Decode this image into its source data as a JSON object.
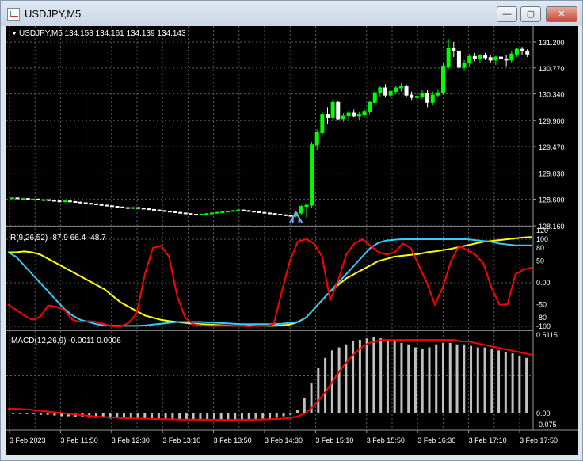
{
  "window": {
    "title": "USDJPY,M5",
    "minimize_glyph": "—",
    "maximize_glyph": "▢",
    "close_glyph": "✕"
  },
  "colors": {
    "background": "#000000",
    "grid": "#5a5a5a",
    "bull_candle": "#00ff00",
    "bear_candle": "#ffffff",
    "rsi_fast": "#ff0000",
    "rsi_mid": "#33ccff",
    "rsi_slow": "#ffff00",
    "macd_hist": "#c0c0c0",
    "macd_signal": "#ff0000",
    "arrow": "#6fa8ff"
  },
  "main_panel": {
    "header": "USDJPY,M5  134.158 134.161 134.139 134.143",
    "price_ticks": [
      "131.200",
      "130.770",
      "130.340",
      "129.900",
      "129.470",
      "129.030",
      "128.600",
      "128.160"
    ]
  },
  "rsi_panel": {
    "header": "R(9,26,52) -87.9 66.4 -48.7",
    "ticks": [
      "120",
      "100",
      "80",
      "50",
      "0.00",
      "-50",
      "-80",
      "-100"
    ]
  },
  "macd_panel": {
    "header": "MACD(12,26,9) -0.0011 0.0006",
    "ticks": [
      "0.5115",
      "0.00",
      "-0.075"
    ]
  },
  "time_labels": [
    "3 Feb 2023",
    "3 Feb 11:50",
    "3 Feb 12:30",
    "3 Feb 13:10",
    "3 Feb 13:50",
    "3 Feb 14:30",
    "3 Feb 15:10",
    "3 Feb 15:50",
    "3 Feb 16:30",
    "3 Feb 17:10",
    "3 Feb 17:50"
  ],
  "chart_data": {
    "type": "candlestick",
    "symbol": "USDJPY",
    "timeframe": "M5",
    "ylim": [
      128.16,
      131.2
    ],
    "candles_ohlc": [
      [
        128.62,
        128.63,
        128.61,
        128.62
      ],
      [
        128.62,
        128.63,
        128.6,
        128.61
      ],
      [
        128.61,
        128.62,
        128.6,
        128.61
      ],
      [
        128.61,
        128.62,
        128.59,
        128.6
      ],
      [
        128.6,
        128.61,
        128.59,
        128.6
      ],
      [
        128.6,
        128.61,
        128.58,
        128.59
      ],
      [
        128.59,
        128.6,
        128.58,
        128.59
      ],
      [
        128.59,
        128.6,
        128.57,
        128.58
      ],
      [
        128.58,
        128.59,
        128.56,
        128.57
      ],
      [
        128.57,
        128.58,
        128.55,
        128.56
      ],
      [
        128.56,
        128.58,
        128.55,
        128.57
      ],
      [
        128.57,
        128.58,
        128.55,
        128.56
      ],
      [
        128.56,
        128.57,
        128.54,
        128.55
      ],
      [
        128.55,
        128.56,
        128.53,
        128.54
      ],
      [
        128.54,
        128.55,
        128.52,
        128.53
      ],
      [
        128.53,
        128.54,
        128.51,
        128.52
      ],
      [
        128.52,
        128.53,
        128.5,
        128.51
      ],
      [
        128.51,
        128.52,
        128.49,
        128.5
      ],
      [
        128.5,
        128.51,
        128.48,
        128.49
      ],
      [
        128.49,
        128.5,
        128.47,
        128.48
      ],
      [
        128.48,
        128.49,
        128.46,
        128.47
      ],
      [
        128.47,
        128.48,
        128.45,
        128.46
      ],
      [
        128.46,
        128.47,
        128.44,
        128.45
      ],
      [
        128.45,
        128.47,
        128.44,
        128.46
      ],
      [
        128.46,
        128.47,
        128.44,
        128.45
      ],
      [
        128.45,
        128.46,
        128.43,
        128.44
      ],
      [
        128.44,
        128.45,
        128.42,
        128.43
      ],
      [
        128.43,
        128.44,
        128.41,
        128.42
      ],
      [
        128.42,
        128.43,
        128.4,
        128.41
      ],
      [
        128.41,
        128.42,
        128.39,
        128.4
      ],
      [
        128.4,
        128.41,
        128.38,
        128.39
      ],
      [
        128.39,
        128.4,
        128.37,
        128.38
      ],
      [
        128.38,
        128.39,
        128.36,
        128.37
      ],
      [
        128.37,
        128.38,
        128.35,
        128.36
      ],
      [
        128.36,
        128.37,
        128.34,
        128.35
      ],
      [
        128.35,
        128.36,
        128.33,
        128.34
      ],
      [
        128.34,
        128.36,
        128.33,
        128.35
      ],
      [
        128.35,
        128.37,
        128.34,
        128.36
      ],
      [
        128.36,
        128.38,
        128.35,
        128.37
      ],
      [
        128.37,
        128.39,
        128.36,
        128.38
      ],
      [
        128.38,
        128.4,
        128.37,
        128.39
      ],
      [
        128.39,
        128.41,
        128.38,
        128.4
      ],
      [
        128.4,
        128.42,
        128.39,
        128.41
      ],
      [
        128.41,
        128.43,
        128.4,
        128.42
      ],
      [
        128.42,
        128.43,
        128.4,
        128.41
      ],
      [
        128.41,
        128.42,
        128.39,
        128.4
      ],
      [
        128.4,
        128.41,
        128.38,
        128.39
      ],
      [
        128.39,
        128.4,
        128.37,
        128.38
      ],
      [
        128.38,
        128.39,
        128.36,
        128.37
      ],
      [
        128.37,
        128.38,
        128.35,
        128.36
      ],
      [
        128.36,
        128.37,
        128.34,
        128.35
      ],
      [
        128.35,
        128.36,
        128.33,
        128.34
      ],
      [
        128.34,
        128.35,
        128.32,
        128.33
      ],
      [
        128.33,
        128.34,
        128.31,
        128.32
      ],
      [
        128.32,
        128.38,
        128.3,
        128.37
      ],
      [
        128.37,
        128.5,
        128.34,
        128.48
      ],
      [
        128.48,
        128.52,
        128.3,
        128.5
      ],
      [
        128.5,
        129.55,
        128.45,
        129.5
      ],
      [
        129.5,
        129.75,
        129.4,
        129.7
      ],
      [
        129.7,
        130.05,
        129.65,
        130.0
      ],
      [
        130.0,
        130.12,
        129.85,
        129.95
      ],
      [
        129.95,
        130.25,
        129.9,
        130.2
      ],
      [
        130.2,
        130.22,
        129.9,
        129.93
      ],
      [
        129.93,
        130.02,
        129.88,
        129.98
      ],
      [
        129.98,
        130.06,
        129.92,
        130.02
      ],
      [
        130.02,
        130.08,
        129.95,
        129.97
      ],
      [
        129.97,
        130.05,
        129.9,
        130.0
      ],
      [
        130.0,
        130.1,
        129.95,
        130.05
      ],
      [
        130.05,
        130.22,
        130.0,
        130.2
      ],
      [
        130.2,
        130.4,
        130.15,
        130.36
      ],
      [
        130.36,
        130.48,
        130.3,
        130.44
      ],
      [
        130.44,
        130.5,
        130.28,
        130.32
      ],
      [
        130.32,
        130.42,
        130.27,
        130.38
      ],
      [
        130.38,
        130.47,
        130.33,
        130.44
      ],
      [
        130.44,
        130.52,
        130.38,
        130.47
      ],
      [
        130.47,
        130.5,
        130.28,
        130.32
      ],
      [
        130.32,
        130.38,
        130.24,
        130.28
      ],
      [
        130.28,
        130.35,
        130.22,
        130.3
      ],
      [
        130.3,
        130.4,
        130.25,
        130.35
      ],
      [
        130.35,
        130.4,
        130.12,
        130.2
      ],
      [
        130.2,
        130.38,
        130.15,
        130.32
      ],
      [
        130.32,
        130.42,
        130.28,
        130.36
      ],
      [
        130.36,
        130.85,
        130.32,
        130.8
      ],
      [
        130.8,
        131.25,
        130.75,
        131.1
      ],
      [
        131.1,
        131.2,
        130.95,
        131.05
      ],
      [
        131.05,
        131.08,
        130.7,
        130.78
      ],
      [
        130.78,
        130.9,
        130.72,
        130.85
      ],
      [
        130.85,
        131.0,
        130.8,
        130.96
      ],
      [
        130.96,
        131.02,
        130.88,
        130.92
      ],
      [
        130.92,
        131.0,
        130.85,
        130.97
      ],
      [
        130.97,
        131.02,
        130.9,
        130.94
      ],
      [
        130.94,
        130.98,
        130.85,
        130.9
      ],
      [
        130.9,
        130.97,
        130.82,
        130.95
      ],
      [
        130.95,
        131.0,
        130.88,
        130.92
      ],
      [
        130.92,
        130.98,
        130.8,
        130.9
      ],
      [
        130.9,
        131.05,
        130.85,
        131.0
      ],
      [
        131.0,
        131.1,
        130.95,
        131.08
      ],
      [
        131.08,
        131.12,
        130.98,
        131.05
      ],
      [
        131.05,
        131.08,
        130.95,
        131.0
      ]
    ],
    "signal_arrow": {
      "index": 54,
      "type": "buy"
    },
    "rsi_series": {
      "ylim": [
        -100,
        120
      ],
      "fast": [
        -50,
        -62,
        -75,
        -85,
        -78,
        -52,
        -55,
        -62,
        -85,
        -90,
        -88,
        -90,
        -95,
        -100,
        -100,
        -92,
        -70,
        20,
        80,
        85,
        60,
        -30,
        -80,
        -95,
        -98,
        -99,
        -99,
        -99,
        -99,
        -99,
        -100,
        -99,
        -99,
        -95,
        -20,
        50,
        95,
        100,
        90,
        60,
        -40,
        5,
        65,
        90,
        100,
        85,
        70,
        65,
        70,
        90,
        80,
        40,
        0,
        -50,
        -10,
        50,
        85,
        75,
        65,
        45,
        -10,
        -50,
        -50,
        20,
        30,
        35
      ],
      "mid": [
        70,
        60,
        40,
        20,
        0,
        -20,
        -40,
        -60,
        -75,
        -85,
        -90,
        -95,
        -98,
        -99,
        -99,
        -99,
        -99,
        -98,
        -96,
        -94,
        -92,
        -90,
        -90,
        -90,
        -90,
        -91,
        -92,
        -93,
        -94,
        -95,
        -95,
        -95,
        -95,
        -95,
        -94,
        -92,
        -90,
        -80,
        -60,
        -40,
        -20,
        0,
        20,
        40,
        60,
        80,
        92,
        97,
        99,
        100,
        100,
        100,
        100,
        100,
        100,
        100,
        100,
        100,
        98,
        96,
        94,
        90,
        88,
        86,
        86,
        86
      ],
      "slow": [
        70,
        70,
        72,
        70,
        65,
        55,
        45,
        35,
        25,
        15,
        5,
        -5,
        -15,
        -30,
        -45,
        -55,
        -65,
        -75,
        -80,
        -85,
        -88,
        -90,
        -92,
        -94,
        -95,
        -96,
        -97,
        -98,
        -99,
        -99,
        -99,
        -99,
        -99,
        -99,
        -98,
        -96,
        -90,
        -80,
        -60,
        -40,
        -20,
        -5,
        10,
        20,
        30,
        40,
        50,
        55,
        60,
        62,
        64,
        66,
        70,
        72,
        75,
        78,
        82,
        86,
        90,
        94,
        96,
        98,
        100,
        102,
        104,
        105
      ]
    },
    "macd_series": {
      "ylim": [
        -0.075,
        0.5115
      ],
      "histogram": [
        0.0,
        0.0,
        0.0,
        -0.005,
        -0.01,
        -0.01,
        -0.015,
        -0.02,
        -0.02,
        -0.025,
        -0.025,
        -0.03,
        -0.03,
        -0.03,
        -0.035,
        -0.035,
        -0.035,
        -0.035,
        -0.04,
        -0.04,
        -0.04,
        -0.04,
        -0.04,
        -0.045,
        -0.045,
        -0.045,
        -0.045,
        -0.045,
        -0.045,
        -0.045,
        -0.045,
        -0.045,
        -0.045,
        -0.045,
        -0.04,
        -0.04,
        -0.035,
        -0.035,
        -0.03,
        -0.02,
        -0.01,
        0.02,
        0.1,
        0.2,
        0.3,
        0.37,
        0.42,
        0.44,
        0.46,
        0.48,
        0.49,
        0.5,
        0.51,
        0.5,
        0.49,
        0.48,
        0.47,
        0.46,
        0.44,
        0.43,
        0.44,
        0.46,
        0.47,
        0.47,
        0.46,
        0.46,
        0.45,
        0.44,
        0.44,
        0.43,
        0.42,
        0.41,
        0.4,
        0.38,
        0.37
      ],
      "signal": [
        0.03,
        0.03,
        0.028,
        0.025,
        0.02,
        0.015,
        0.01,
        0.005,
        0.0,
        -0.005,
        -0.01,
        -0.015,
        -0.02,
        -0.023,
        -0.026,
        -0.029,
        -0.031,
        -0.033,
        -0.035,
        -0.036,
        -0.037,
        -0.038,
        -0.039,
        -0.04,
        -0.041,
        -0.042,
        -0.042,
        -0.043,
        -0.043,
        -0.043,
        -0.044,
        -0.044,
        -0.044,
        -0.044,
        -0.043,
        -0.042,
        -0.041,
        -0.04,
        -0.038,
        -0.035,
        -0.03,
        -0.02,
        0.0,
        0.04,
        0.09,
        0.15,
        0.22,
        0.29,
        0.35,
        0.4,
        0.44,
        0.47,
        0.48,
        0.49,
        0.49,
        0.49,
        0.49,
        0.49,
        0.49,
        0.49,
        0.49,
        0.49,
        0.49,
        0.49,
        0.48,
        0.48,
        0.47,
        0.46,
        0.45,
        0.44,
        0.43,
        0.42,
        0.41,
        0.4,
        0.39
      ]
    }
  }
}
